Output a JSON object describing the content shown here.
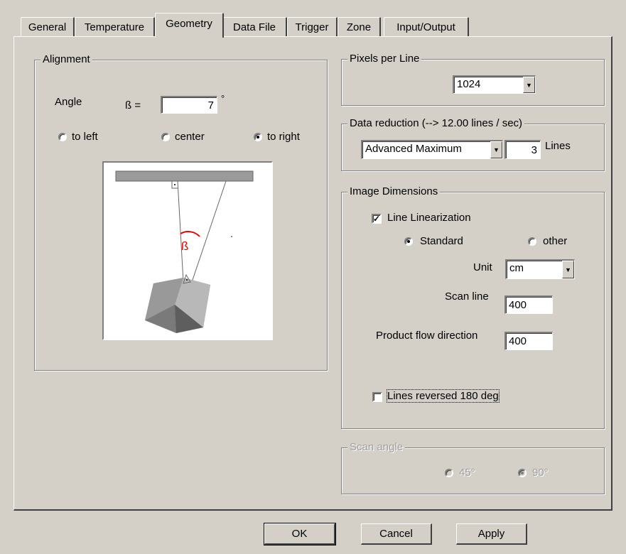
{
  "tabs": [
    {
      "label": "General"
    },
    {
      "label": "Temperature"
    },
    {
      "label": "Geometry"
    },
    {
      "label": "Data File"
    },
    {
      "label": "Trigger"
    },
    {
      "label": "Zone"
    },
    {
      "label": "Input/Output"
    }
  ],
  "active_tab": "Geometry",
  "alignment": {
    "title": "Alignment",
    "angle_label": "Angle",
    "beta_label": "ß =",
    "beta_value": "7",
    "degree_symbol": "°",
    "options": [
      {
        "label": "to left"
      },
      {
        "label": "center"
      },
      {
        "label": "to right"
      }
    ],
    "selected": "to right",
    "diagram_beta": "ß"
  },
  "pixels_per_line": {
    "title": "Pixels per Line",
    "value": "1024"
  },
  "data_reduction": {
    "title": "Data reduction (--> 12.00 lines / sec)",
    "mode": "Advanced Maximum",
    "lines_value": "3",
    "lines_label": "Lines"
  },
  "image_dimensions": {
    "title": "Image Dimensions",
    "line_linearization_label": "Line Linearization",
    "line_linearization_checked": true,
    "standard_label": "Standard",
    "other_label": "other",
    "selected": "Standard",
    "unit_label": "Unit",
    "unit_value": "cm",
    "scan_line_label": "Scan line",
    "scan_line_value": "400",
    "product_flow_label": "Product flow direction",
    "product_flow_value": "400",
    "lines_reversed_label": "Lines reversed 180 deg",
    "lines_reversed_checked": false
  },
  "scan_angle": {
    "title": "Scan angle",
    "options": [
      {
        "label": "45°"
      },
      {
        "label": "90°"
      }
    ],
    "selected": "90°",
    "enabled": false
  },
  "buttons": {
    "ok": "OK",
    "cancel": "Cancel",
    "apply": "Apply"
  }
}
